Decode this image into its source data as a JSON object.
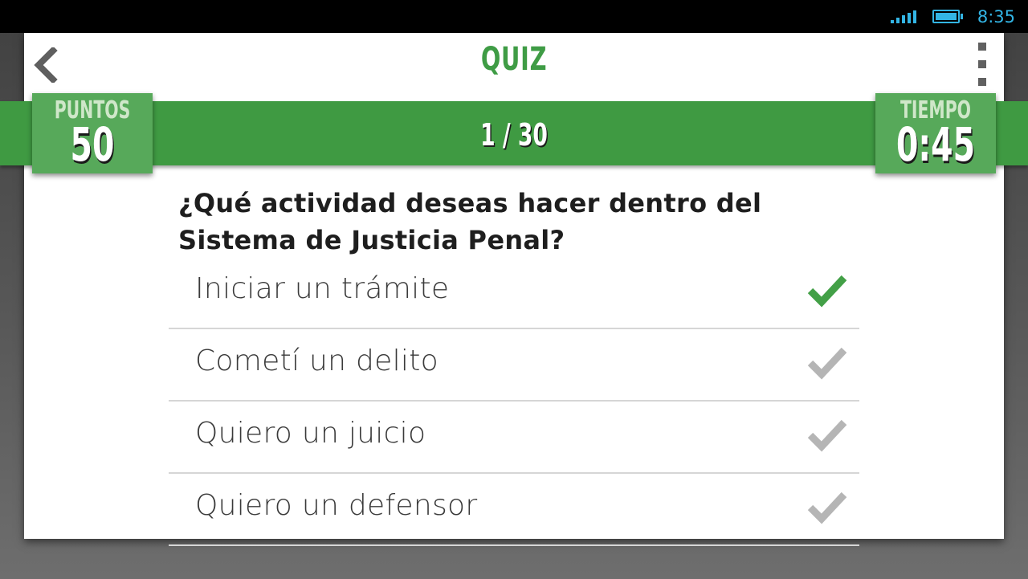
{
  "status_bar": {
    "time": "8:35",
    "icons": [
      "signal-icon",
      "battery-icon"
    ],
    "color": "#33b5e5"
  },
  "header": {
    "title": "QUIZ",
    "back_icon": "chevron-left-icon",
    "menu_icon": "overflow-menu-icon",
    "accent_color": "#3f9c45"
  },
  "score": {
    "points_label": "PUNTOS",
    "points_value": "50",
    "time_label": "TIEMPO",
    "time_value": "0:45",
    "progress": "1 / 30"
  },
  "question": {
    "text": "¿Qué actividad deseas hacer dentro del Sistema de Justicia Penal?"
  },
  "options": [
    {
      "label": "Iniciar un trámite",
      "icon": "checkmark-icon",
      "selected": true,
      "color": "#43a047"
    },
    {
      "label": "Cometí un delito",
      "icon": "checkmark-icon",
      "selected": false,
      "color": "#b5b5b5"
    },
    {
      "label": "Quiero un juicio",
      "icon": "checkmark-icon",
      "selected": false,
      "color": "#b5b5b5"
    },
    {
      "label": "Quiero un defensor",
      "icon": "checkmark-icon",
      "selected": false,
      "color": "#b5b5b5"
    }
  ]
}
